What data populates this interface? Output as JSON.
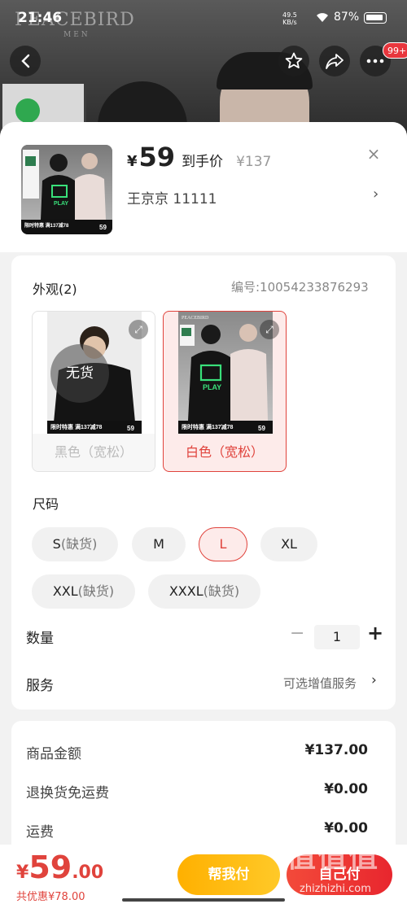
{
  "status_bar": {
    "time": "21:46",
    "net_speed": "49.5",
    "net_unit": "KB/s",
    "battery": "87%"
  },
  "background": {
    "brand": "PEACEBIRD",
    "brand_sub": "MEN",
    "more_badge": "99+"
  },
  "header": {
    "price_symbol": "¥",
    "price": "59",
    "price_tag": "到手价",
    "original_price": "¥137",
    "close": "×",
    "address": "王京京  11111",
    "address_chevron": "›"
  },
  "appearance": {
    "title": "外观(2)",
    "sku": "编号:10054233876293",
    "options": [
      {
        "label": "黑色（宽松）",
        "overlay": "无货",
        "selected": false
      },
      {
        "label": "白色（宽松）",
        "selected": true
      }
    ],
    "promo": "限时特惠 满137减78",
    "promo_price": "59",
    "play": "PLAY"
  },
  "size": {
    "title": "尺码",
    "options": [
      {
        "main": "S",
        "note": "(缺货)"
      },
      {
        "main": "M",
        "note": ""
      },
      {
        "main": "L",
        "note": ""
      },
      {
        "main": "XL",
        "note": ""
      },
      {
        "main": "XXL",
        "note": "(缺货)"
      },
      {
        "main": "XXXL",
        "note": "(缺货)"
      }
    ],
    "selected": "L"
  },
  "quantity": {
    "title": "数量",
    "minus": "−",
    "value": "1",
    "plus": "+"
  },
  "service": {
    "title": "服务",
    "hint": "可选增值服务",
    "chevron": "›"
  },
  "fees": [
    {
      "label": "商品金额",
      "value": "¥137.00"
    },
    {
      "label": "退换货免运费",
      "value": "¥0.00"
    },
    {
      "label": "运费",
      "value": "¥0.00"
    }
  ],
  "bottom": {
    "symbol": "¥",
    "integer": "59",
    "decimal": ".00",
    "savings": "共优惠¥78.00",
    "help_pay": "帮我付",
    "self_pay": "自己付"
  },
  "watermark": {
    "text": "值值值",
    "url": "zhizhizhi.com"
  },
  "colors": {
    "accent": "#e0433c",
    "help_btn": "#ffb000",
    "play_green": "#39e07a"
  }
}
